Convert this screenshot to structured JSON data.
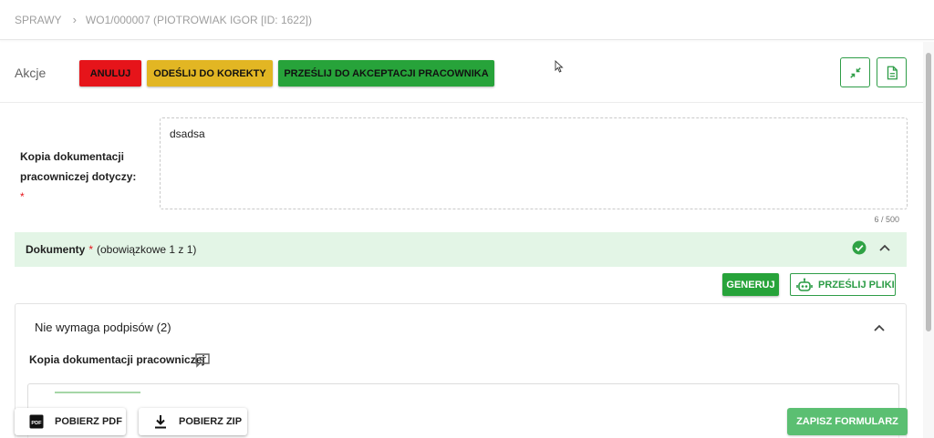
{
  "breadcrumb": {
    "root": "SPRAWY",
    "current": "WO1/000007 (PIOTROWIAK IGOR [ID: 1622])"
  },
  "actions": {
    "label": "Akcje",
    "cancel": "ANULUJ",
    "send_back": "ODEŚLIJ DO KOREKTY",
    "send_accept": "PRZEŚLIJ DO AKCEPTACJI PRACOWNIKA",
    "icons": [
      "collapse-icon",
      "document-icon"
    ]
  },
  "form": {
    "field_label": "Kopia dokumentacji pracowniczej dotyczy:",
    "required_mark": "*",
    "field_value": "dsadsa",
    "counter": "6 / 500"
  },
  "documents": {
    "title": "Dokumenty",
    "required_mark": "*",
    "subtitle": "(obowiązkowe 1 z 1)",
    "generate_button": "GENERUJ",
    "upload_button": "PRZEŚLIJ PLIKI",
    "group_title": "Nie wymaga podpisów (2)",
    "item_title": "Kopia dokumentacji pracowniczej"
  },
  "footer": {
    "pdf_button": "POBIERZ PDF",
    "zip_button": "POBIERZ ZIP",
    "save_button": "ZAPISZ FORMULARZ"
  },
  "colors": {
    "danger": "#e6141a",
    "warning": "#e2b623",
    "success": "#27a33a",
    "success_light": "#e3f5e6",
    "save_disabled": "#5bbf72"
  }
}
